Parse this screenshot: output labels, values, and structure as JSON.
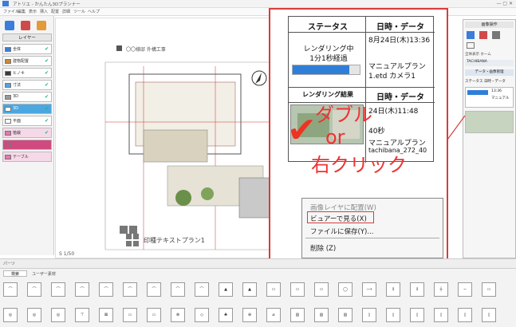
{
  "window": {
    "title": "アトリエ - かんたん3Dプランナー"
  },
  "menu": [
    "ファイル",
    "編集",
    "表示",
    "挿入",
    "配置",
    "詳細",
    "ツール",
    "ヘルプ"
  ],
  "left_panel": {
    "title": "レイヤー",
    "layers": [
      {
        "label": "全体",
        "color": "#3b7dd8"
      },
      {
        "label": "建物配置",
        "color": "#c58a3a"
      },
      {
        "label": "ヒノキ",
        "color": "#3a3a3a"
      },
      {
        "label": "寸法",
        "color": "#5aa0e0"
      },
      {
        "label": "3D",
        "color": "#999999"
      },
      {
        "label": "3D",
        "color": "#3aa0d0"
      },
      {
        "label": "平面",
        "color": "#444444"
      },
      {
        "label": "植栽",
        "color": "#e07ab0"
      },
      {
        "label": "",
        "color": "#d04a80"
      },
      {
        "label": "テーブル",
        "color": "#e07ab0"
      }
    ]
  },
  "canvas": {
    "header": "〇〇様邸  外構工事",
    "footer": "印種テキストプラン1",
    "scale": "S 1/50"
  },
  "right_panel": {
    "title": "画像操作",
    "tabs": [
      "全体表示",
      "ホーム",
      "ツール"
    ],
    "section": "TACHIBANA",
    "subhead": "データ・画像管理",
    "cols": [
      "ステータス",
      "日時・データ"
    ],
    "entry_time": "13:36",
    "entry_name": "マニュアル"
  },
  "render_table": {
    "col1": "ステータス",
    "col2": "日時・データ",
    "row1_status": "レンダリング中",
    "row1_elapsed": "1分1秒経過",
    "row1_date": "8月24日(木)13:36",
    "row1_plan": "マニュアルプラン",
    "row1_file": "1.etd カメラ1",
    "progress": 0.85,
    "col3": "レンダリング結果",
    "col4": "日時・データ",
    "row2_date": "24日(木)11:48",
    "row2_elapsed": "40秒",
    "row2_plan": "マニュアルプラン",
    "row2_file": "tachibana_272_40"
  },
  "annotation": {
    "line1": "ダブル",
    "line2": "or",
    "line3": "右クリック"
  },
  "context_menu": {
    "items": [
      "画像レイヤに配置(W)",
      "ビュアーで見る(X)",
      "ファイルに保存(Y)...",
      "削除 (Z)"
    ]
  },
  "bottom_panel": {
    "tab1": "ユーザー素材",
    "label": "パーツ",
    "search": "検索"
  },
  "colors": {
    "accent": "#d93c3c",
    "progress": "#2f7fd8"
  }
}
